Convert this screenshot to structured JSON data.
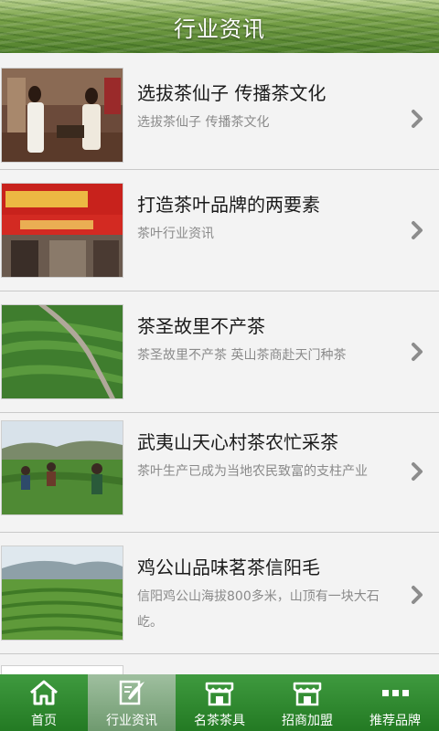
{
  "header": {
    "title": "行业资讯"
  },
  "articles": [
    {
      "title": "选拔茶仙子 传播茶文化",
      "desc": "选拔茶仙子 传播茶文化",
      "image": "tea-ceremony-photo"
    },
    {
      "title": "打造茶叶品牌的两要素",
      "desc": "茶叶行业资讯",
      "image": "tea-shop-storefront-photo"
    },
    {
      "title": "茶圣故里不产茶",
      "desc": "茶圣故里不产茶 英山茶商赴天门种茶",
      "image": "tea-plantation-photo"
    },
    {
      "title": "武夷山天心村茶农忙采茶",
      "desc": "茶叶生产已成为当地农民致富的支柱产业",
      "image": "tea-pickers-photo"
    },
    {
      "title": "鸡公山品味茗茶信阳毛",
      "desc": "信阳鸡公山海拔800多米，山顶有一块大石屹。",
      "image": "hillside-tea-garden-photo"
    }
  ],
  "tabbar": {
    "tabs": [
      {
        "label": "首页",
        "icon": "home-icon",
        "active": false
      },
      {
        "label": "行业资讯",
        "icon": "news-icon",
        "active": true
      },
      {
        "label": "名茶茶具",
        "icon": "shop-icon",
        "active": false
      },
      {
        "label": "招商加盟",
        "icon": "shop-icon",
        "active": false
      },
      {
        "label": "推荐品牌",
        "icon": "more-icon",
        "active": false
      }
    ]
  },
  "colors": {
    "tabbar": "#237a23",
    "tab_active": "#8fb08f",
    "title": "#1a1a1a",
    "desc": "#8a8a8a"
  }
}
